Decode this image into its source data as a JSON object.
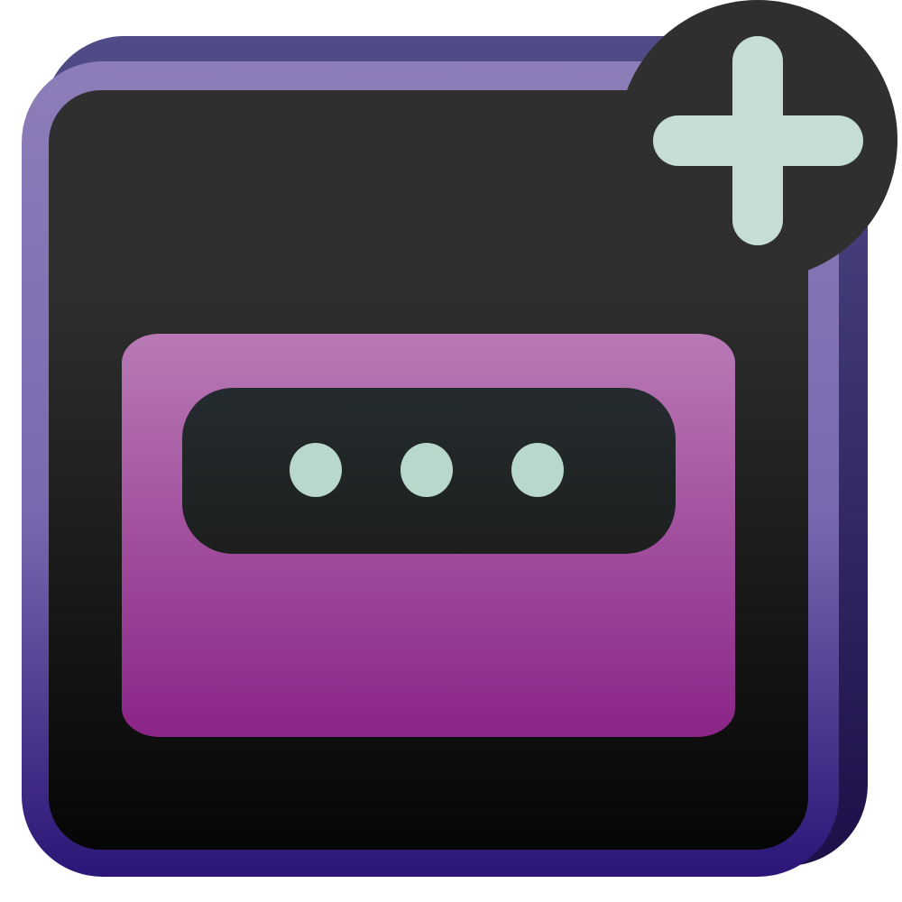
{
  "icon": {
    "name": "add-password-field-icon",
    "plus_badge_icon": "plus-icon",
    "field_icon": "password-field-icon",
    "masked_value": "•••"
  },
  "colors": {
    "back_plate_top": "#514c88",
    "back_plate_bottom": "#1d0f48",
    "frame_top": "#8d7db8",
    "frame_bottom": "#2b1577",
    "panel_top": "#2f2f2f",
    "panel_bottom": "#060606",
    "card_top": "#b87ab5",
    "card_bottom": "#8b2487",
    "field_top": "#242b2f",
    "field_bottom": "#1d1f1e",
    "dot": "#b8d8cc",
    "badge": "#2f2f2f",
    "plus": "#c5ddd5"
  }
}
